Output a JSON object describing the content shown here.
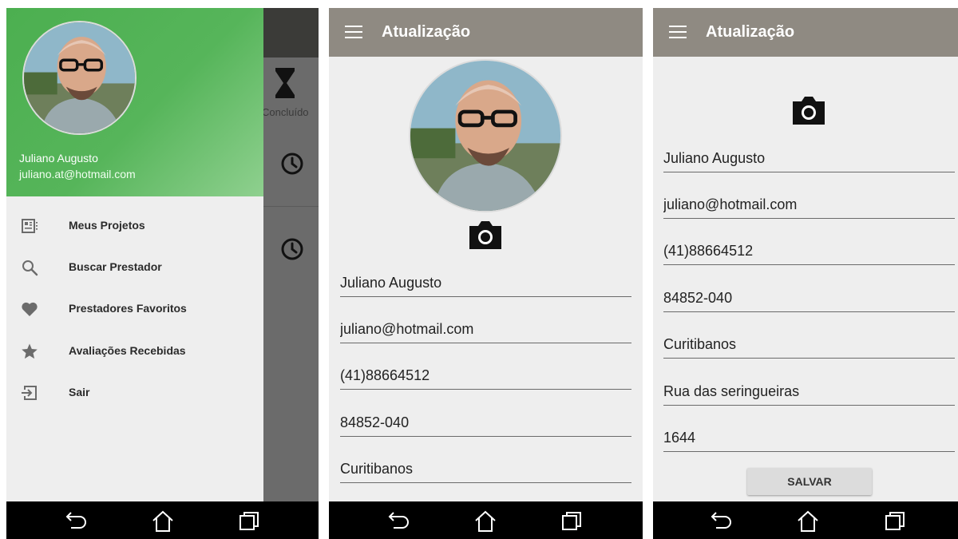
{
  "drawer_screen": {
    "user_name": "Juliano Augusto",
    "user_email": "juliano.at@hotmail.com",
    "background_status_label": "Concluído",
    "menu_items": [
      {
        "label": "Meus Projetos",
        "icon": "projects-icon"
      },
      {
        "label": "Buscar Prestador",
        "icon": "search-icon"
      },
      {
        "label": "Prestadores Favoritos",
        "icon": "heart-icon"
      },
      {
        "label": "Avaliações Recebidas",
        "icon": "star-icon"
      },
      {
        "label": "Sair",
        "icon": "exit-icon"
      }
    ]
  },
  "update_screen": {
    "title": "Atualização",
    "fields": {
      "name": "Juliano Augusto",
      "email": "juliano@hotmail.com",
      "phone": "(41)88664512",
      "cep": "84852-040",
      "city": "Curitibanos"
    }
  },
  "update_screen_scrolled": {
    "title": "Atualização",
    "fields": {
      "name": "Juliano Augusto",
      "email": "juliano@hotmail.com",
      "phone": "(41)88664512",
      "cep": "84852-040",
      "city": "Curitibanos",
      "street": "Rua das seringueiras",
      "number": "1644"
    },
    "save_label": "SALVAR"
  },
  "navigation_bar": {
    "buttons": [
      "back-icon",
      "home-icon",
      "recents-icon"
    ]
  },
  "colors": {
    "drawer_header_green": "#4caf50",
    "app_bar": "#8f8a82",
    "screen_background": "#eeeeee",
    "navigation_bar": "#000000"
  }
}
